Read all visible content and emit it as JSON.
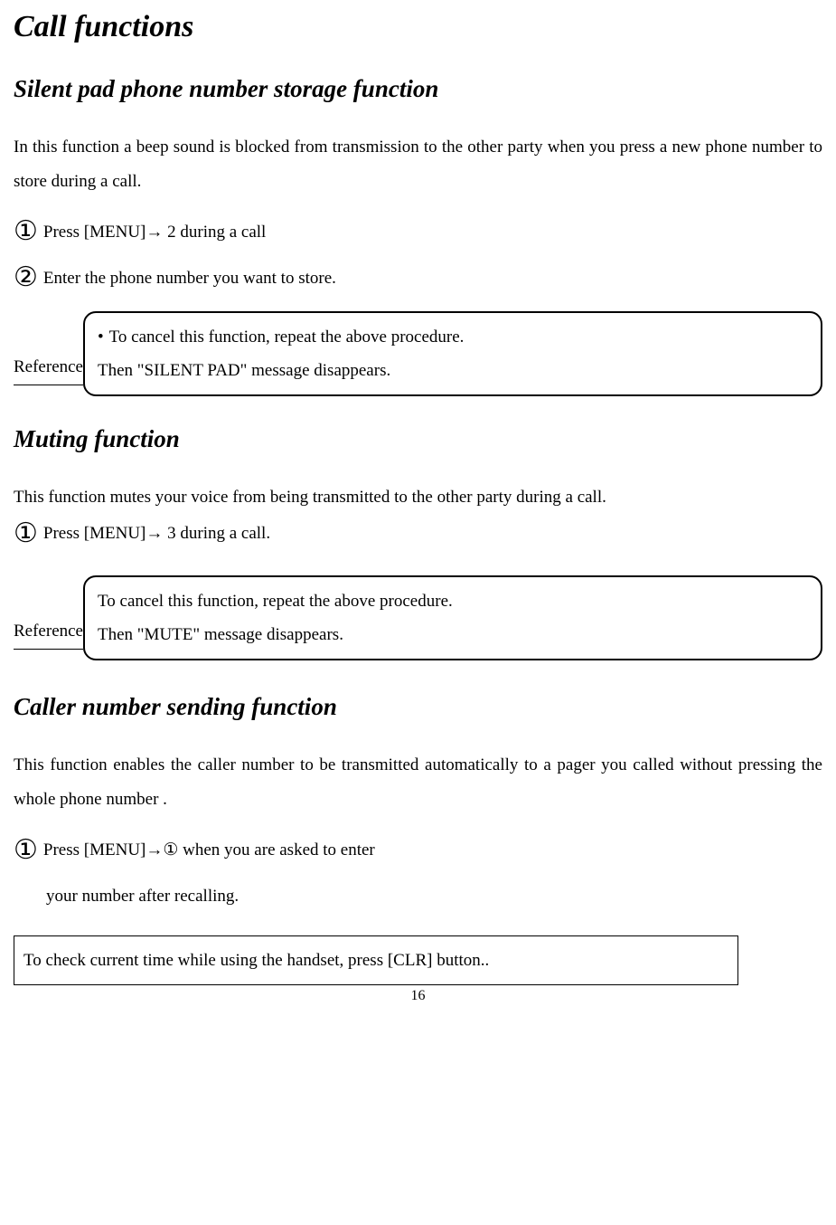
{
  "title": "Call functions",
  "section1": {
    "heading": "Silent pad phone number storage function",
    "intro": "In this function a beep sound is blocked from transmission to the other party when you press a new phone number to store during a call.",
    "step1_marker": "①",
    "step1_text": " Press [MENU]→ 2 during a call",
    "step2_marker": "②",
    "step2_text": "Enter the phone number you want to store.",
    "ref_label": "Reference",
    "ref_bullet": "•",
    "ref_line1": "To cancel this function, repeat the above procedure.",
    "ref_line2": "Then \"SILENT PAD\" message disappears."
  },
  "section2": {
    "heading": "Muting function",
    "intro": "This function mutes your voice from being transmitted to the other party during a call.",
    "step1_marker": "①",
    "step1_text": " Press [MENU]→ 3 during a call.",
    "ref_label": "Reference",
    "ref_line1": "To cancel this function, repeat the above procedure.",
    "ref_line2": "Then \"MUTE\"  message disappears."
  },
  "section3": {
    "heading": "Caller number sending function",
    "intro": "This function enables the caller number to be transmitted automatically to a pager you called without pressing the whole phone number .",
    "step1_marker": "①",
    "step1_text": "Press [MENU]→① when you are asked to enter",
    "step1_cont": "your number after recalling."
  },
  "footer_note": "To check current time while using the handset, press [CLR] button..",
  "page_number": "16"
}
